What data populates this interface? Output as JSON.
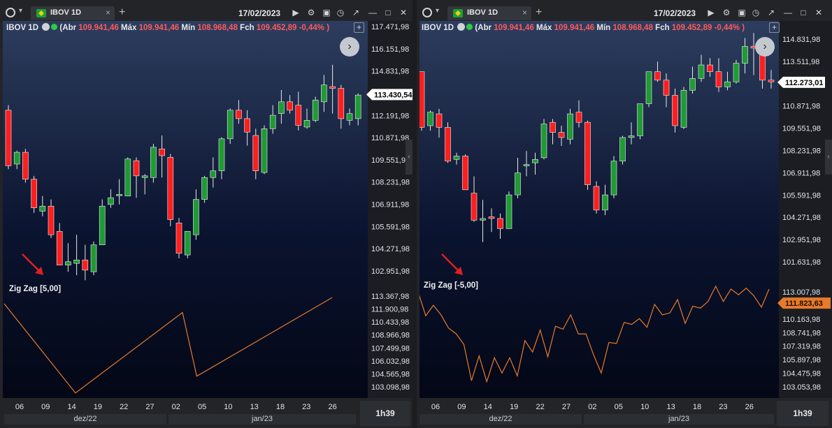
{
  "panels": [
    {
      "toolbar": {
        "tab_title": "IBOV 1D",
        "close": "×",
        "add": "+",
        "date": "17/02/2023"
      },
      "ohlc": {
        "symbol": "IBOV 1D",
        "abr_label": "Abr",
        "abr": "109.941,46",
        "max_label": "Máx",
        "max": "109.941,46",
        "min_label": "Mín",
        "min": "108.968,48",
        "fch_label": "Fch",
        "fch": "109.452,89 -0,44% )",
        "open_paren": "("
      },
      "indicator_label": "Zig Zag [5,00]",
      "price_axis": [
        "117.471,98",
        "116.151,98",
        "114.831,98",
        "113.511,98",
        "112.191,98",
        "110.871,98",
        "109.551,98",
        "108.231,98",
        "106.911,98",
        "105.591,98",
        "104.271,98",
        "102.951,98"
      ],
      "price_tag": "113.430,54",
      "ind_axis": [
        "113.367,98",
        "111.900,98",
        "110.433,98",
        "108.966,98",
        "107.499,98",
        "106.032,98",
        "104.565,98",
        "103.098,98"
      ],
      "x_ticks": [
        "06",
        "09",
        "14",
        "19",
        "22",
        "27",
        "02",
        "05",
        "10",
        "13",
        "18",
        "23",
        "26"
      ],
      "months": [
        "dez/22",
        "jan/23"
      ],
      "time": "1h39"
    },
    {
      "toolbar": {
        "tab_title": "IBOV 1D",
        "close": "×",
        "add": "+",
        "date": "17/02/2023"
      },
      "ohlc": {
        "symbol": "IBOV 1D",
        "abr_label": "Abr",
        "abr": "109.941,46",
        "max_label": "Máx",
        "max": "109.941,46",
        "min_label": "Mín",
        "min": "108.968,48",
        "fch_label": "Fch",
        "fch": "109.452,89 -0,44% )",
        "open_paren": "("
      },
      "indicator_label": "Zig Zag [-5,00]",
      "price_axis": [
        "114.831,98",
        "113.511,98",
        "112.191,98",
        "110.871,98",
        "109.551,98",
        "108.231,98",
        "106.911,98",
        "105.591,98",
        "104.271,98",
        "102.951,98",
        "101.631,98"
      ],
      "price_tag": "112.273,01",
      "ind_axis": [
        "113.007,98",
        "111.823,63",
        "110.163,98",
        "108.741,98",
        "107.319,98",
        "105.897,98",
        "104.475,98",
        "103.053,98"
      ],
      "ind_tag": "111.823,63",
      "x_ticks": [
        "06",
        "09",
        "14",
        "19",
        "22",
        "27",
        "02",
        "05",
        "10",
        "13",
        "18",
        "23",
        "26"
      ],
      "months": [
        "dez/22",
        "jan/23"
      ],
      "time": "1h39"
    }
  ],
  "colors": {
    "up": "#1f9a34",
    "down": "#ff1e1e",
    "line": "#e87a2a",
    "arrow": "#e02020"
  },
  "chart_data": [
    {
      "type": "candlestick",
      "title": "IBOV 1D",
      "candles": [
        {
          "o": 112.5,
          "h": 112.8,
          "l": 109.0,
          "c": 109.2
        },
        {
          "o": 109.3,
          "h": 110.1,
          "l": 109.0,
          "c": 110.0
        },
        {
          "o": 110.0,
          "h": 110.2,
          "l": 108.2,
          "c": 108.4
        },
        {
          "o": 108.4,
          "h": 108.6,
          "l": 106.4,
          "c": 106.7
        },
        {
          "o": 106.5,
          "h": 107.4,
          "l": 106.2,
          "c": 106.8
        },
        {
          "o": 106.8,
          "h": 107.2,
          "l": 104.9,
          "c": 105.1
        },
        {
          "o": 105.3,
          "h": 105.8,
          "l": 104.2,
          "c": 103.3
        },
        {
          "o": 103.3,
          "h": 104.6,
          "l": 102.9,
          "c": 103.5
        },
        {
          "o": 103.4,
          "h": 105.1,
          "l": 102.7,
          "c": 103.6
        },
        {
          "o": 103.6,
          "h": 104.5,
          "l": 102.4,
          "c": 103.0
        },
        {
          "o": 102.9,
          "h": 104.7,
          "l": 102.7,
          "c": 104.5
        },
        {
          "o": 104.5,
          "h": 107.2,
          "l": 104.5,
          "c": 106.8
        },
        {
          "o": 106.9,
          "h": 107.8,
          "l": 106.7,
          "c": 107.3
        },
        {
          "o": 107.5,
          "h": 108.4,
          "l": 106.9,
          "c": 107.5
        },
        {
          "o": 107.4,
          "h": 109.7,
          "l": 107.4,
          "c": 109.6
        },
        {
          "o": 109.5,
          "h": 109.7,
          "l": 107.3,
          "c": 108.6
        },
        {
          "o": 108.5,
          "h": 108.7,
          "l": 107.5,
          "c": 108.6
        },
        {
          "o": 108.5,
          "h": 110.5,
          "l": 108.2,
          "c": 110.3
        },
        {
          "o": 110.2,
          "h": 111.0,
          "l": 108.5,
          "c": 109.8
        },
        {
          "o": 109.7,
          "h": 109.9,
          "l": 105.6,
          "c": 106.0
        },
        {
          "o": 105.8,
          "h": 106.1,
          "l": 103.7,
          "c": 104.0
        },
        {
          "o": 103.9,
          "h": 105.3,
          "l": 103.7,
          "c": 105.3
        },
        {
          "o": 105.1,
          "h": 107.8,
          "l": 104.8,
          "c": 107.2
        },
        {
          "o": 107.2,
          "h": 108.6,
          "l": 107.0,
          "c": 108.5
        },
        {
          "o": 108.5,
          "h": 109.7,
          "l": 107.9,
          "c": 108.9
        },
        {
          "o": 108.9,
          "h": 110.9,
          "l": 108.4,
          "c": 110.8
        },
        {
          "o": 110.8,
          "h": 112.6,
          "l": 110.5,
          "c": 112.5
        },
        {
          "o": 112.5,
          "h": 113.1,
          "l": 111.7,
          "c": 112.0
        },
        {
          "o": 112.0,
          "h": 112.5,
          "l": 110.4,
          "c": 111.2
        },
        {
          "o": 111.0,
          "h": 111.4,
          "l": 108.4,
          "c": 108.9
        },
        {
          "o": 108.8,
          "h": 111.6,
          "l": 108.7,
          "c": 111.4
        },
        {
          "o": 111.4,
          "h": 112.8,
          "l": 111.1,
          "c": 112.2
        },
        {
          "o": 112.3,
          "h": 113.7,
          "l": 111.7,
          "c": 113.0
        },
        {
          "o": 113.0,
          "h": 113.4,
          "l": 112.3,
          "c": 112.5
        },
        {
          "o": 112.8,
          "h": 113.6,
          "l": 111.3,
          "c": 111.6
        },
        {
          "o": 111.5,
          "h": 112.6,
          "l": 111.4,
          "c": 111.9
        },
        {
          "o": 111.9,
          "h": 113.3,
          "l": 111.8,
          "c": 113.1
        },
        {
          "o": 113.0,
          "h": 114.6,
          "l": 112.4,
          "c": 114.0
        },
        {
          "o": 113.9,
          "h": 115.2,
          "l": 112.3,
          "c": 113.8
        },
        {
          "o": 113.8,
          "h": 114.0,
          "l": 111.4,
          "c": 112.0
        },
        {
          "o": 111.9,
          "h": 112.6,
          "l": 111.6,
          "c": 112.3
        },
        {
          "o": 112.0,
          "h": 113.5,
          "l": 111.6,
          "c": 113.4
        }
      ],
      "zigzag": [
        {
          "i": 0,
          "v": 112.5
        },
        {
          "i": 10,
          "v": 102.4
        },
        {
          "i": 25,
          "v": 111.5
        },
        {
          "i": 27,
          "v": 104.3
        },
        {
          "i": 46,
          "v": 113.2
        }
      ]
    },
    {
      "type": "candlestick",
      "title": "IBOV 1D",
      "candles": [
        {
          "o": 112.9,
          "h": 112.8,
          "l": 109.4,
          "c": 109.6
        },
        {
          "o": 109.7,
          "h": 110.6,
          "l": 109.4,
          "c": 110.5
        },
        {
          "o": 110.4,
          "h": 110.7,
          "l": 109.0,
          "c": 109.6
        },
        {
          "o": 109.6,
          "h": 109.9,
          "l": 107.5,
          "c": 107.6
        },
        {
          "o": 107.7,
          "h": 108.1,
          "l": 107.4,
          "c": 107.9
        },
        {
          "o": 107.9,
          "h": 108.0,
          "l": 105.9,
          "c": 105.9
        },
        {
          "o": 105.7,
          "h": 106.7,
          "l": 104.0,
          "c": 104.1
        },
        {
          "o": 104.1,
          "h": 105.3,
          "l": 102.8,
          "c": 104.2
        },
        {
          "o": 104.3,
          "h": 104.8,
          "l": 103.4,
          "c": 104.2
        },
        {
          "o": 104.2,
          "h": 104.5,
          "l": 103.0,
          "c": 103.6
        },
        {
          "o": 103.6,
          "h": 105.8,
          "l": 103.6,
          "c": 105.6
        },
        {
          "o": 105.6,
          "h": 107.8,
          "l": 105.4,
          "c": 106.9
        },
        {
          "o": 107.4,
          "h": 108.2,
          "l": 106.7,
          "c": 107.4
        },
        {
          "o": 107.5,
          "h": 108.1,
          "l": 106.8,
          "c": 107.7
        },
        {
          "o": 107.8,
          "h": 110.1,
          "l": 107.7,
          "c": 109.8
        },
        {
          "o": 109.9,
          "h": 110.1,
          "l": 108.6,
          "c": 109.3
        },
        {
          "o": 109.3,
          "h": 109.7,
          "l": 108.5,
          "c": 109.0
        },
        {
          "o": 108.9,
          "h": 110.7,
          "l": 108.6,
          "c": 110.4
        },
        {
          "o": 110.5,
          "h": 111.2,
          "l": 109.6,
          "c": 109.9
        },
        {
          "o": 109.9,
          "h": 110.0,
          "l": 105.9,
          "c": 106.2
        },
        {
          "o": 106.1,
          "h": 106.4,
          "l": 104.5,
          "c": 104.7
        },
        {
          "o": 104.7,
          "h": 106.2,
          "l": 104.4,
          "c": 105.6
        },
        {
          "o": 105.6,
          "h": 107.9,
          "l": 105.4,
          "c": 107.6
        },
        {
          "o": 107.6,
          "h": 109.1,
          "l": 107.4,
          "c": 109.0
        },
        {
          "o": 109.0,
          "h": 109.9,
          "l": 108.6,
          "c": 109.1
        },
        {
          "o": 109.1,
          "h": 111.0,
          "l": 108.9,
          "c": 111.0
        },
        {
          "o": 111.0,
          "h": 112.9,
          "l": 110.8,
          "c": 112.9
        },
        {
          "o": 112.9,
          "h": 113.5,
          "l": 112.3,
          "c": 112.4
        },
        {
          "o": 112.4,
          "h": 112.8,
          "l": 110.8,
          "c": 111.5
        },
        {
          "o": 111.5,
          "h": 111.9,
          "l": 109.3,
          "c": 109.7
        },
        {
          "o": 109.6,
          "h": 112.0,
          "l": 109.5,
          "c": 111.8
        },
        {
          "o": 111.8,
          "h": 113.2,
          "l": 111.6,
          "c": 112.5
        },
        {
          "o": 112.5,
          "h": 113.9,
          "l": 112.3,
          "c": 113.3
        },
        {
          "o": 113.3,
          "h": 113.7,
          "l": 112.6,
          "c": 112.9
        },
        {
          "o": 112.9,
          "h": 113.7,
          "l": 111.7,
          "c": 112.0
        },
        {
          "o": 112.0,
          "h": 112.9,
          "l": 111.8,
          "c": 112.3
        },
        {
          "o": 112.3,
          "h": 113.6,
          "l": 112.2,
          "c": 113.4
        },
        {
          "o": 113.4,
          "h": 114.9,
          "l": 112.8,
          "c": 114.4
        },
        {
          "o": 114.4,
          "h": 115.2,
          "l": 112.7,
          "c": 114.3
        },
        {
          "o": 114.2,
          "h": 114.3,
          "l": 111.9,
          "c": 112.4
        },
        {
          "o": 112.4,
          "h": 113.0,
          "l": 111.9,
          "c": 112.3
        }
      ],
      "zigzag": [
        113.0,
        110.5,
        111.6,
        110.6,
        109.2,
        108.6,
        107.5,
        103.7,
        106.3,
        103.6,
        106.1,
        104.5,
        106.1,
        104.2,
        107.9,
        106.7,
        109.0,
        106.2,
        109.4,
        109.1,
        110.6,
        108.6,
        108.6,
        106.4,
        104.5,
        107.7,
        107.6,
        109.8,
        109.6,
        110.2,
        109.3,
        111.7,
        110.6,
        110.8,
        112.2,
        109.7,
        111.5,
        111.3,
        112.0,
        113.6,
        112.0,
        113.3,
        112.7,
        113.4,
        112.6,
        111.4,
        113.3
      ]
    }
  ]
}
